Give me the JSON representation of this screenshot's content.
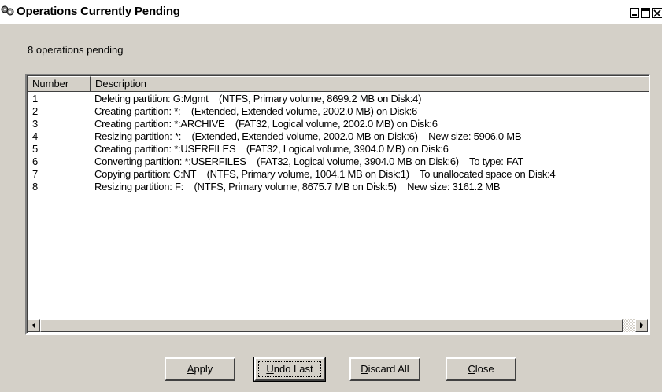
{
  "window": {
    "title": "Operations Currently Pending",
    "icon": "disk-operations-icon"
  },
  "status": {
    "pending_text": "8 operations pending"
  },
  "list": {
    "columns": [
      "Number",
      "Description"
    ],
    "rows": [
      {
        "number": "1",
        "description": "Deleting partition: G:Mgmt    (NTFS, Primary volume, 8699.2 MB on Disk:4)"
      },
      {
        "number": "2",
        "description": "Creating partition: *:    (Extended, Extended volume, 2002.0 MB) on Disk:6"
      },
      {
        "number": "3",
        "description": "Creating partition: *:ARCHIVE    (FAT32, Logical volume, 2002.0 MB) on Disk:6"
      },
      {
        "number": "4",
        "description": "Resizing partition: *:    (Extended, Extended volume, 2002.0 MB on Disk:6)    New size: 5906.0 MB"
      },
      {
        "number": "5",
        "description": "Creating partition: *:USERFILES    (FAT32, Logical volume, 3904.0 MB) on Disk:6"
      },
      {
        "number": "6",
        "description": "Converting partition: *:USERFILES    (FAT32, Logical volume, 3904.0 MB on Disk:6)    To type: FAT"
      },
      {
        "number": "7",
        "description": "Copying partition: C:NT    (NTFS, Primary volume, 1004.1 MB on Disk:1)    To unallocated space on Disk:4"
      },
      {
        "number": "8",
        "description": "Resizing partition: F:    (NTFS, Primary volume, 8675.7 MB on Disk:5)    New size: 3161.2 MB"
      }
    ]
  },
  "buttons": {
    "apply": {
      "hotkey": "A",
      "rest": "pply"
    },
    "undo_last": {
      "hotkey": "U",
      "rest": "ndo Last"
    },
    "discard_all": {
      "hotkey": "D",
      "rest": "iscard All"
    },
    "close": {
      "hotkey": "C",
      "rest": "lose"
    }
  },
  "colors": {
    "face": "#d4d0c8",
    "list_background": "#ffffff",
    "text": "#000000"
  }
}
